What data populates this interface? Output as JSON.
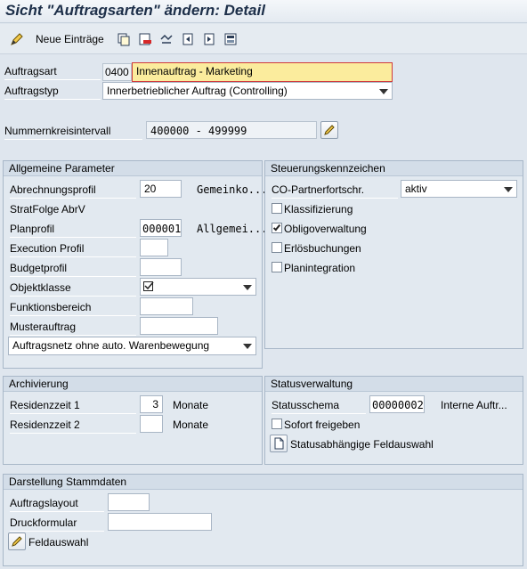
{
  "title": "Sicht \"Auftragsarten\" ändern: Detail",
  "toolbar": {
    "new_entries_label": "Neue Einträge",
    "icons": [
      "copy-icon",
      "delete-icon",
      "undo-icon",
      "previous-icon",
      "next-icon",
      "transport-icon"
    ]
  },
  "header": {
    "auftragsart_label": "Auftragsart",
    "auftragsart_code": "0400",
    "auftragsart_text": "Innenauftrag - Marketing",
    "auftragstyp_label": "Auftragstyp",
    "auftragstyp_value": "Innerbetrieblicher Auftrag (Controlling)",
    "nummernkreis_label": "Nummernkreisintervall",
    "nummernkreis_value": "400000 - 499999"
  },
  "allgemein": {
    "title": "Allgemeine Parameter",
    "abrechnungsprofil_label": "Abrechnungsprofil",
    "abrechnungsprofil_value": "20",
    "abrechnungsprofil_desc": "Gemeinko...",
    "stratfolge_label": "StratFolge AbrV",
    "planprofil_label": "Planprofil",
    "planprofil_value": "000001",
    "planprofil_desc": "Allgemei...",
    "execution_label": "Execution Profil",
    "execution_value": "",
    "budget_label": "Budgetprofil",
    "budget_value": "",
    "objektklasse_label": "Objektklasse",
    "objektklasse_value": "",
    "funktionsbereich_label": "Funktionsbereich",
    "funktionsbereich_value": "",
    "musterauftrag_label": "Musterauftrag",
    "musterauftrag_value": "",
    "auftragsnetz_value": "Auftragsnetz ohne auto. Warenbewegung"
  },
  "steuerung": {
    "title": "Steuerungskennzeichen",
    "co_label": "CO-Partnerfortschr.",
    "co_value": "aktiv",
    "klassifizierung_label": "Klassifizierung",
    "klassifizierung_checked": false,
    "obligo_label": "Obligoverwaltung",
    "obligo_checked": true,
    "erloes_label": "Erlösbuchungen",
    "erloes_checked": false,
    "plan_label": "Planintegration",
    "plan_checked": false
  },
  "archivierung": {
    "title": "Archivierung",
    "res1_label": "Residenzzeit 1",
    "res1_value": "3",
    "res1_unit": "Monate",
    "res2_label": "Residenzzeit 2",
    "res2_value": "",
    "res2_unit": "Monate"
  },
  "status": {
    "title": "Statusverwaltung",
    "schema_label": "Statusschema",
    "schema_value": "00000002",
    "schema_desc": "Interne Auftr...",
    "sofort_label": "Sofort freigeben",
    "sofort_checked": false,
    "feldauswahl_label": "Statusabhängige Feldauswahl"
  },
  "stammdaten": {
    "title": "Darstellung Stammdaten",
    "layout_label": "Auftragslayout",
    "layout_value": "",
    "druck_label": "Druckformular",
    "druck_value": "",
    "feldauswahl_label": "Feldauswahl"
  }
}
